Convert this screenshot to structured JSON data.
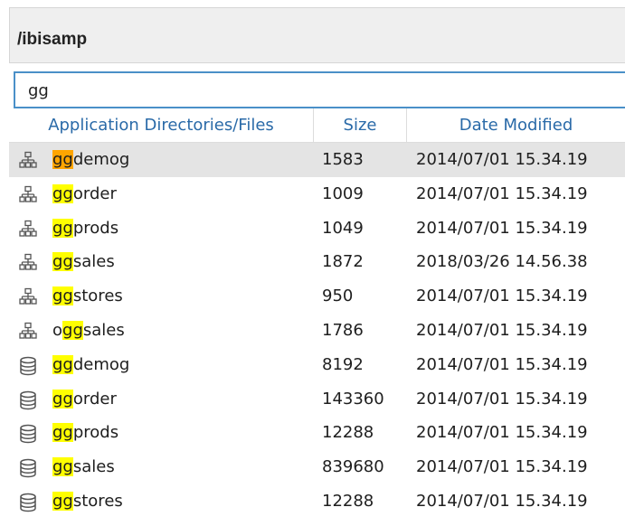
{
  "path": "/ibisamp",
  "search": {
    "value": "gg"
  },
  "columns": {
    "name": "Application Directories/Files",
    "size": "Size",
    "date": "Date Modified"
  },
  "rows": [
    {
      "pre": "",
      "match": "gg",
      "post": "demog",
      "size": "1583",
      "date": "2014/07/01 15.34.19",
      "icon": "master-file-icon",
      "selected": true,
      "active": true
    },
    {
      "pre": "",
      "match": "gg",
      "post": "order",
      "size": "1009",
      "date": "2014/07/01 15.34.19",
      "icon": "master-file-icon"
    },
    {
      "pre": "",
      "match": "gg",
      "post": "prods",
      "size": "1049",
      "date": "2014/07/01 15.34.19",
      "icon": "master-file-icon"
    },
    {
      "pre": "",
      "match": "gg",
      "post": "sales",
      "size": "1872",
      "date": "2018/03/26 14.56.38",
      "icon": "master-file-icon"
    },
    {
      "pre": "",
      "match": "gg",
      "post": "stores",
      "size": "950",
      "date": "2014/07/01 15.34.19",
      "icon": "master-file-icon"
    },
    {
      "pre": "o",
      "match": "gg",
      "post": "sales",
      "size": "1786",
      "date": "2014/07/01 15.34.19",
      "icon": "master-file-icon"
    },
    {
      "pre": "",
      "match": "gg",
      "post": "demog",
      "size": "8192",
      "date": "2014/07/01 15.34.19",
      "icon": "database-icon"
    },
    {
      "pre": "",
      "match": "gg",
      "post": "order",
      "size": "143360",
      "date": "2014/07/01 15.34.19",
      "icon": "database-icon"
    },
    {
      "pre": "",
      "match": "gg",
      "post": "prods",
      "size": "12288",
      "date": "2014/07/01 15.34.19",
      "icon": "database-icon"
    },
    {
      "pre": "",
      "match": "gg",
      "post": "sales",
      "size": "839680",
      "date": "2014/07/01 15.34.19",
      "icon": "database-icon"
    },
    {
      "pre": "",
      "match": "gg",
      "post": "stores",
      "size": "12288",
      "date": "2014/07/01 15.34.19",
      "icon": "database-icon"
    }
  ],
  "colors": {
    "highlight": "#ffff00",
    "active_highlight": "#ffa500",
    "header_text": "#2a6aa8",
    "search_border": "#4a90c8"
  }
}
